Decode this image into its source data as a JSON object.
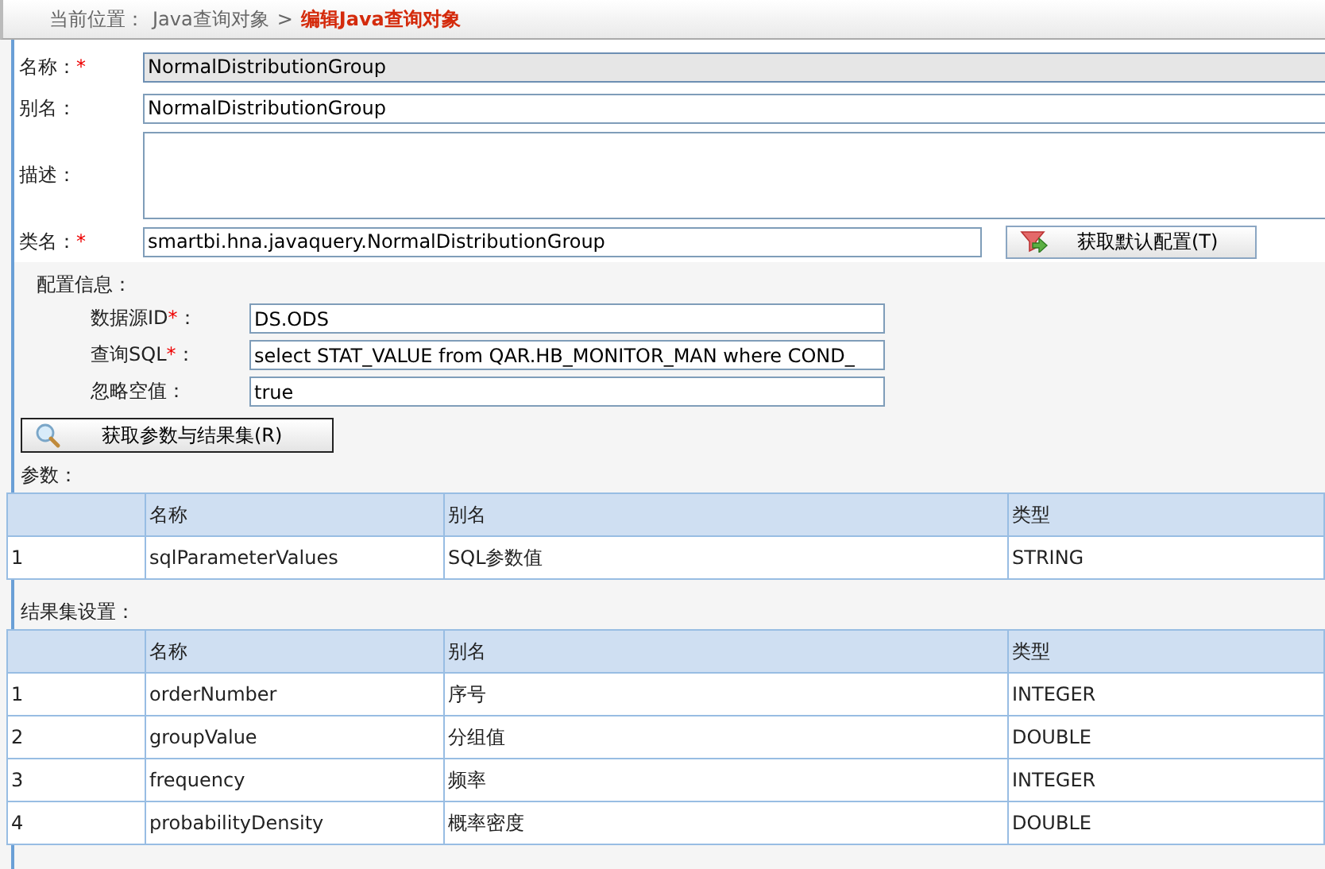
{
  "breadcrumb": {
    "prefix": "当前位置：",
    "parent": "Java查询对象",
    "separator": ">",
    "current": "编辑Java查询对象"
  },
  "fields": [
    {
      "label": "名称：",
      "required_mark": "*",
      "value": "NormalDistributionGroup",
      "kind": "input",
      "readonly": true
    },
    {
      "label": "别名：",
      "value": "NormalDistributionGroup",
      "kind": "input",
      "readonly": false
    },
    {
      "label": "描述：",
      "kind": "textarea",
      "readonly": false
    },
    {
      "label": "类名：",
      "required_mark": "*",
      "value": "smartbi.hna.javaquery.NormalDistributionGroup",
      "kind": "short",
      "readonly": false
    }
  ],
  "default_button": "获取默认配置(T)",
  "config": {
    "title": "配置信息：",
    "fields": [
      {
        "label": "数据源ID",
        "required_mark": "*",
        "label_end": "：",
        "value": "DS.ODS"
      },
      {
        "label": "查询SQL",
        "required_mark": "*",
        "label_end": "：",
        "value": "select STAT_VALUE from QAR.HB_MONITOR_MAN where COND_"
      },
      {
        "label": "忽略空值：",
        "value": "true"
      }
    ]
  },
  "fetch_button": "获取参数与结果集(R)",
  "params": {
    "title": "参数：",
    "columns": [
      "名称",
      "别名",
      "类型"
    ],
    "rows": [
      {
        "index": "1",
        "name": "sqlParameterValues",
        "alias": "SQL参数值",
        "type": "STRING"
      }
    ]
  },
  "results": {
    "title": "结果集设置：",
    "columns": [
      "名称",
      "别名",
      "类型"
    ],
    "rows": [
      {
        "index": "1",
        "name": "orderNumber",
        "alias": "序号",
        "type": "INTEGER"
      },
      {
        "index": "2",
        "name": "groupValue",
        "alias": "分组值",
        "type": "DOUBLE"
      },
      {
        "index": "3",
        "name": "frequency",
        "alias": "频率",
        "type": "INTEGER"
      },
      {
        "index": "4",
        "name": "probabilityDensity",
        "alias": "概率密度",
        "type": "DOUBLE"
      }
    ]
  }
}
